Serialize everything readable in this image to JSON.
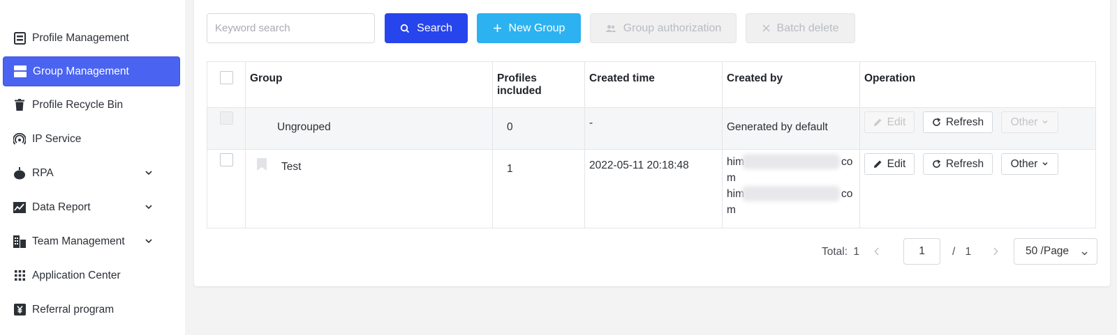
{
  "sidebar": {
    "items": [
      {
        "label": "Profile Management",
        "icon": "profile-icon"
      },
      {
        "label": "Group Management",
        "icon": "group-icon",
        "active": true
      },
      {
        "label": "Profile Recycle Bin",
        "icon": "trash-icon"
      },
      {
        "label": "IP Service",
        "icon": "ip-signal-icon"
      },
      {
        "label": "RPA",
        "icon": "robot-icon",
        "expandable": true
      },
      {
        "label": "Data Report",
        "icon": "chart-icon",
        "expandable": true
      },
      {
        "label": "Team Management",
        "icon": "team-building-icon",
        "expandable": true
      },
      {
        "label": "Application Center",
        "icon": "grid-icon"
      },
      {
        "label": "Referral program",
        "icon": "yen-icon"
      }
    ]
  },
  "toolbar": {
    "search_placeholder": "Keyword search",
    "search_label": "Search",
    "new_group_label": "New Group",
    "group_auth_label": "Group authorization",
    "batch_delete_label": "Batch delete"
  },
  "table": {
    "headers": {
      "group": "Group",
      "profiles_1": "Profiles",
      "profiles_2": "included",
      "created_time": "Created time",
      "created_by": "Created by",
      "operation": "Operation"
    },
    "rows": [
      {
        "group": "Ungrouped",
        "profiles": "0",
        "created_time": "-",
        "created_by": "Generated by default",
        "edit": "Edit",
        "refresh": "Refresh",
        "other": "Other"
      },
      {
        "group": "Test",
        "profiles": "1",
        "created_time": "2022-05-11 20:18:48",
        "created_by_lines": [
          "him",
          "co",
          "m",
          "him",
          "co",
          "m"
        ],
        "edit": "Edit",
        "refresh": "Refresh",
        "other": "Other"
      }
    ]
  },
  "pagination": {
    "total_label": "Total:",
    "total": "1",
    "current_page": "1",
    "separator": "/",
    "page_count": "1",
    "page_size": "50 /Page"
  },
  "colors": {
    "primary": "#2745ec",
    "accent": "#2cb2f0",
    "active_nav": "#4a63f0"
  }
}
